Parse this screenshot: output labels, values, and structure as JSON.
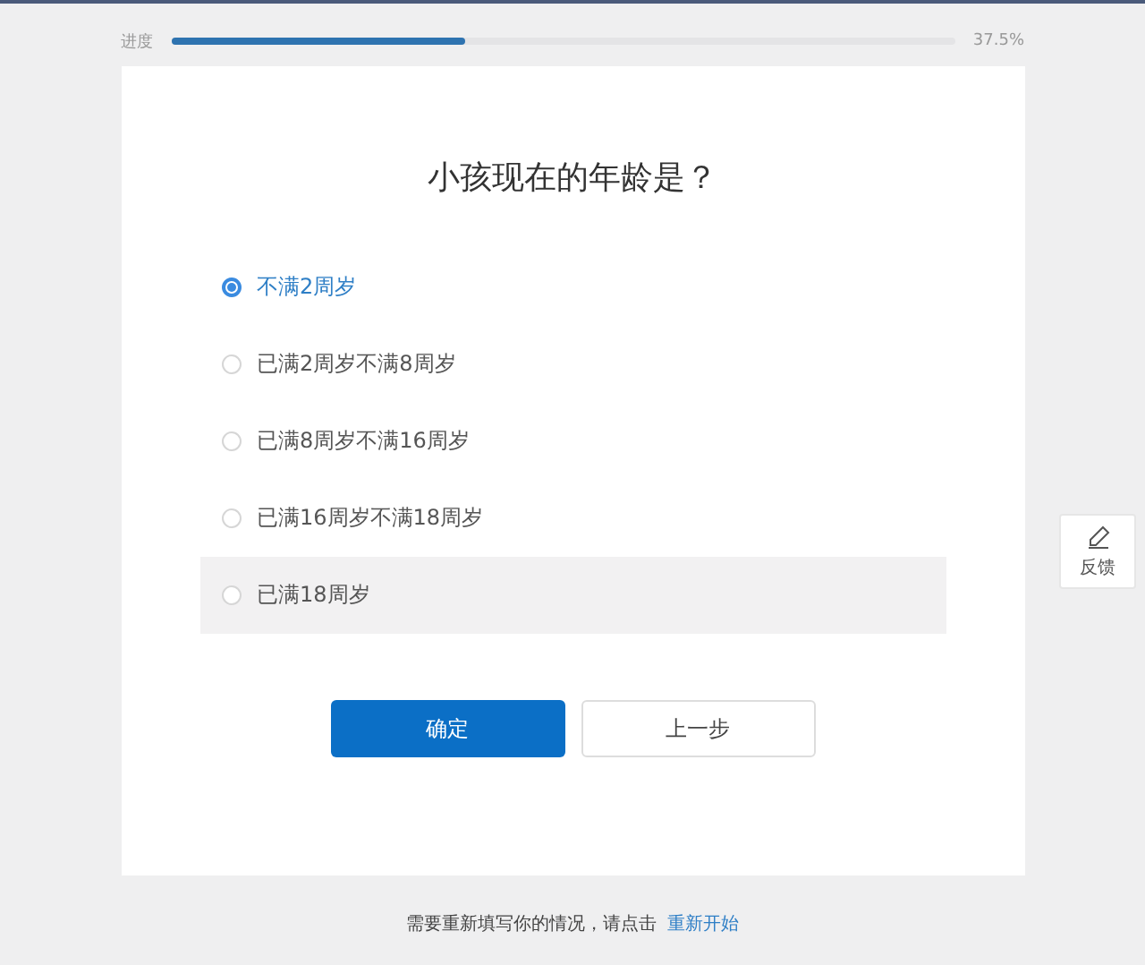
{
  "progress": {
    "label": "进度",
    "level": 0.375,
    "reading": "37.5%"
  },
  "question": {
    "title": "小孩现在的年龄是？",
    "options": [
      {
        "label": "不满2周岁",
        "selected": true,
        "hovered": false
      },
      {
        "label": "已满2周岁不满8周岁",
        "selected": false,
        "hovered": false
      },
      {
        "label": "已满8周岁不满16周岁",
        "selected": false,
        "hovered": false
      },
      {
        "label": "已满16周岁不满18周岁",
        "selected": false,
        "hovered": false
      },
      {
        "label": "已满18周岁",
        "selected": false,
        "hovered": true
      }
    ]
  },
  "buttons": {
    "confirm": "确定",
    "back": "上一步"
  },
  "feedback": {
    "label": "反馈"
  },
  "footer": {
    "text": "需要重新填写你的情况，请点击",
    "link": "重新开始"
  }
}
